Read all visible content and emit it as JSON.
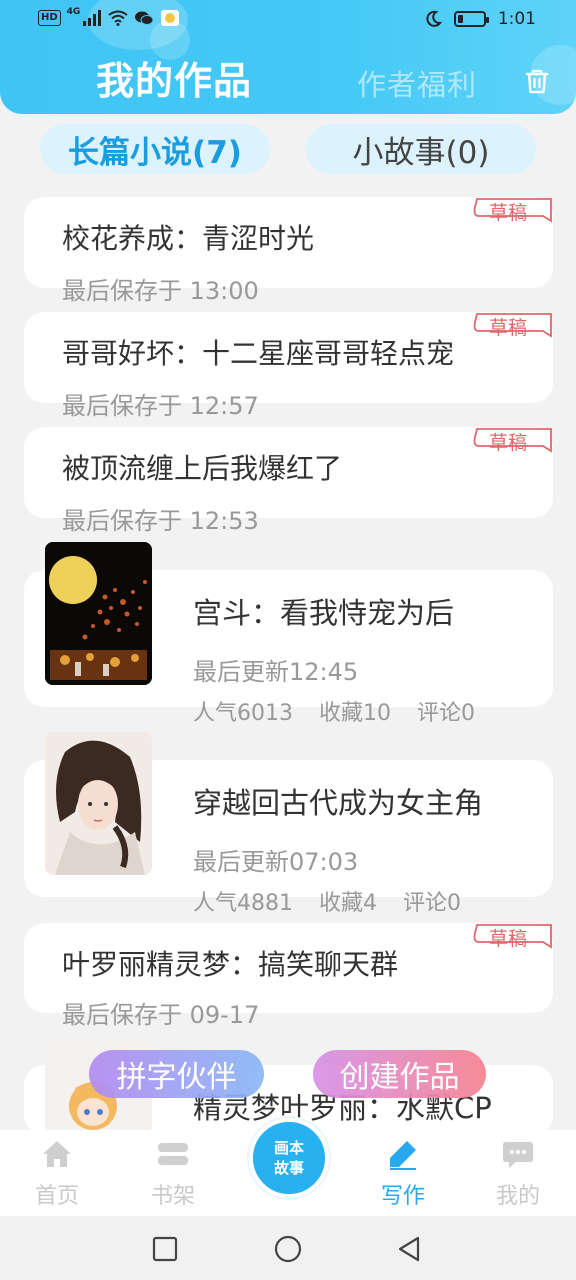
{
  "status_bar": {
    "network_badge": "HD",
    "network_type": "4G",
    "time": "1:01",
    "battery_level": 0.18
  },
  "header": {
    "title": "我的作品",
    "welfare_label": "作者福利",
    "trash_icon": "trash-icon"
  },
  "tabs": [
    {
      "label": "长篇小说(7)",
      "active": true
    },
    {
      "label": "小故事(0)",
      "active": false
    }
  ],
  "drafts": [
    {
      "title": "校花养成：青涩时光",
      "saved": "最后保存于 13:00",
      "badge": "草稿"
    },
    {
      "title": "哥哥好坏：十二星座哥哥轻点宠",
      "saved": "最后保存于 12:57",
      "badge": "草稿"
    },
    {
      "title": "被顶流缠上后我爆红了",
      "saved": "最后保存于 12:53",
      "badge": "草稿"
    }
  ],
  "published": [
    {
      "title": "宫斗：看我恃宠为后",
      "updated": "最后更新12:45",
      "popularity": "人气6013",
      "favorites": "收藏10",
      "comments": "评论0"
    },
    {
      "title": "穿越回古代成为女主角",
      "updated": "最后更新07:03",
      "popularity": "人气4881",
      "favorites": "收藏4",
      "comments": "评论0"
    }
  ],
  "draft_bottom": {
    "title": "叶罗丽精灵梦：搞笑聊天群",
    "saved": "最后保存于 09-17",
    "badge": "草稿"
  },
  "partial_item": {
    "title": "精灵梦叶罗丽：水默CP"
  },
  "floating": {
    "pin_label": "拼字伙伴",
    "create_label": "创建作品"
  },
  "bottom_nav": {
    "home": "首页",
    "shelf": "书架",
    "center_line1": "画本",
    "center_line2": "故事",
    "write": "写作",
    "mine": "我的"
  },
  "colors": {
    "header": "#45c9f6",
    "accent": "#2aa8ef",
    "draft_badge": "#e0676b"
  }
}
